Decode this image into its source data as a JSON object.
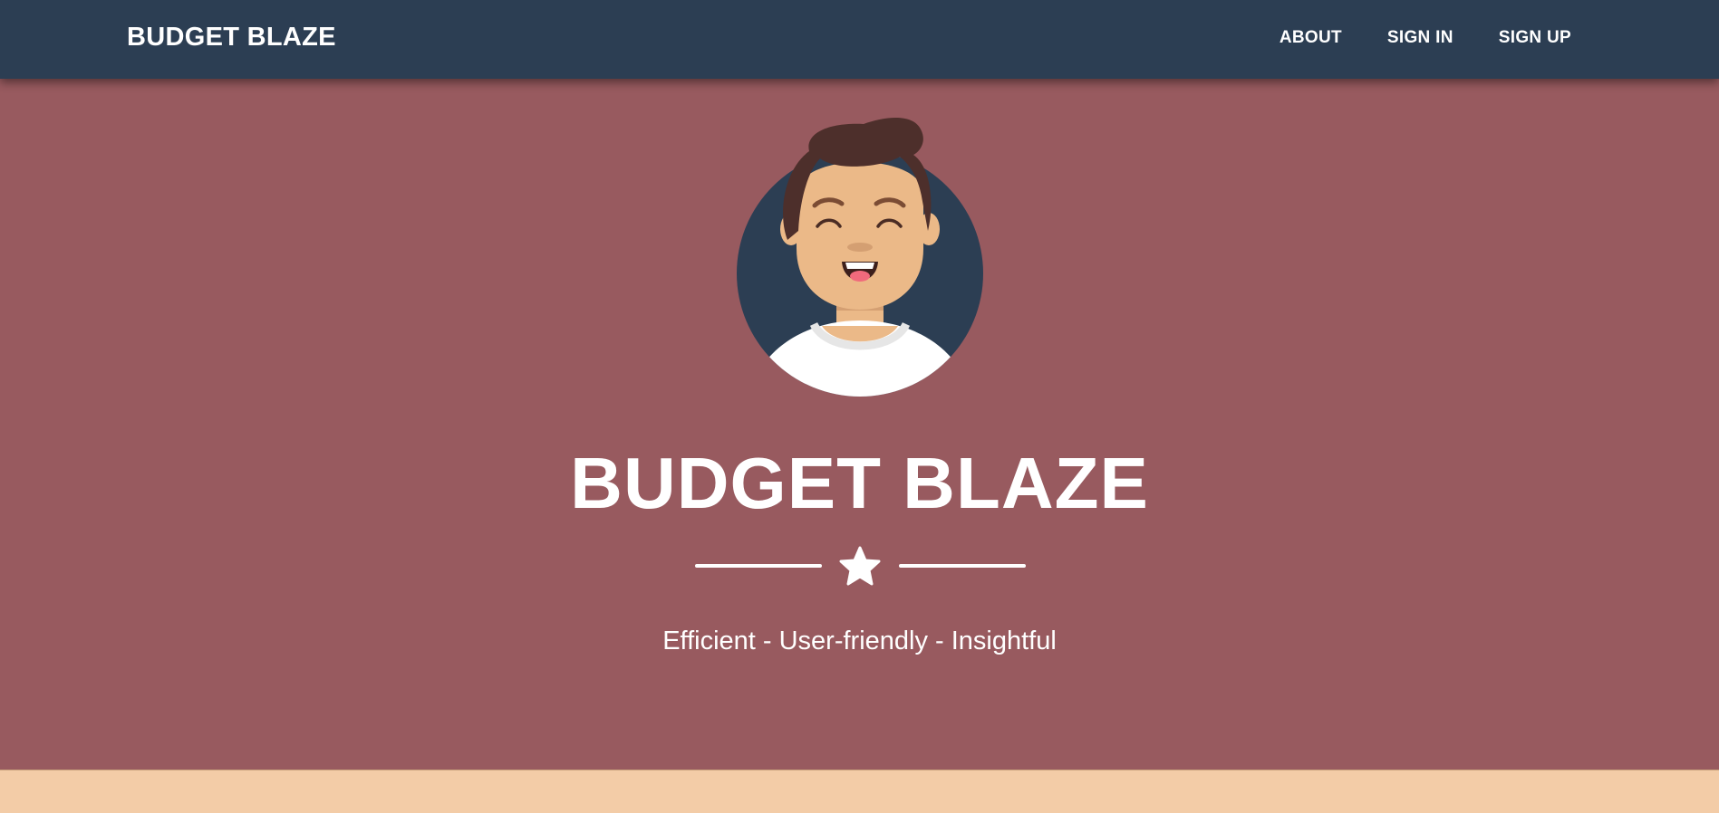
{
  "navbar": {
    "brand": "BUDGET BLAZE",
    "links": [
      "ABOUT",
      "SIGN IN",
      "SIGN UP"
    ]
  },
  "masthead": {
    "avatar_icon": "smiling-person-avatar",
    "title": "BUDGET BLAZE",
    "divider_icon": "star-icon",
    "subtitle": "Efficient - User-friendly - Insightful"
  },
  "colors": {
    "navbar": "#2c3e53",
    "masthead": "#985a5f",
    "next_section": "#f3cca7",
    "text": "#ffffff"
  }
}
